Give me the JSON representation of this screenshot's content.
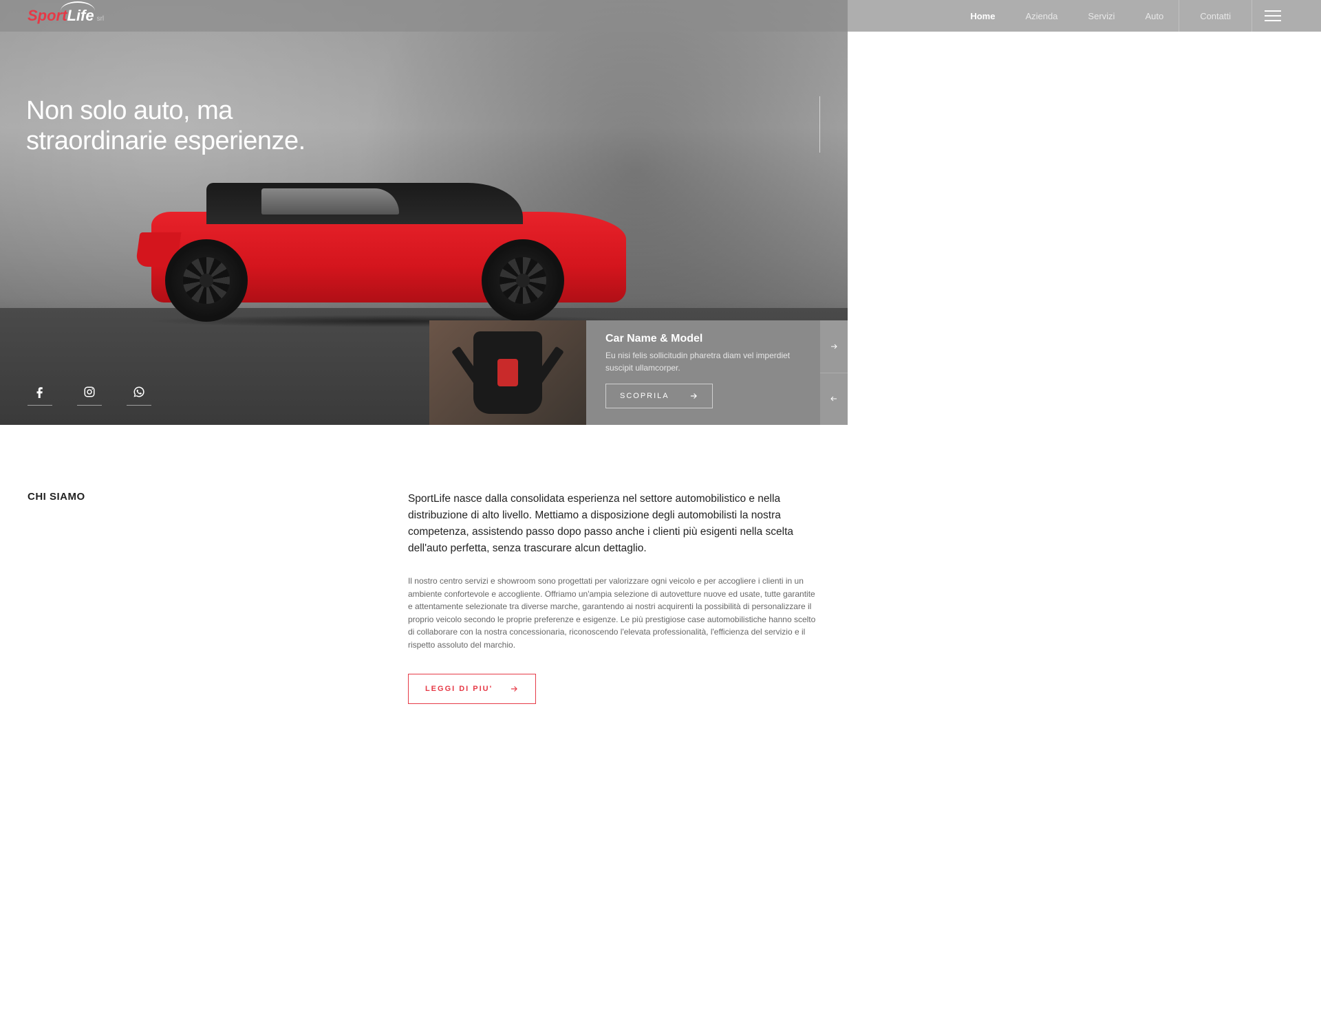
{
  "brand": {
    "part1": "Sport",
    "part2": "Life",
    "suffix": "srl"
  },
  "nav": {
    "items": [
      {
        "label": "Home",
        "active": true
      },
      {
        "label": "Azienda",
        "active": false
      },
      {
        "label": "Servizi",
        "active": false
      },
      {
        "label": "Auto",
        "active": false
      },
      {
        "label": "Contatti",
        "active": false
      }
    ]
  },
  "hero": {
    "title_line1": "Non solo auto, ma",
    "title_line2": "straordinarie esperienze."
  },
  "socials": [
    {
      "name": "facebook"
    },
    {
      "name": "instagram"
    },
    {
      "name": "whatsapp"
    }
  ],
  "featured": {
    "title": "Car Name & Model",
    "description": "Eu nisi felis sollicitudin pharetra diam vel imperdiet suscipit ullamcorper.",
    "cta": "SCOPRILA"
  },
  "about": {
    "heading": "CHI SIAMO",
    "lead": "SportLife nasce dalla consolidata esperienza nel settore automobilistico e nella distribuzione di alto livello. Mettiamo a disposizione degli automobilisti la nostra competenza, assistendo passo dopo passo anche i clienti più esigenti nella scelta dell'auto perfetta, senza trascurare alcun dettaglio.",
    "paragraph": "Il nostro centro servizi e showroom sono progettati per valorizzare ogni veicolo e per accogliere i clienti in un ambiente confortevole e accogliente. Offriamo un'ampia selezione di autovetture nuove ed usate, tutte garantite e attentamente selezionate tra diverse marche, garantendo ai nostri acquirenti la possibilità di personalizzare il proprio veicolo secondo le proprie preferenze e esigenze. Le più prestigiose case automobilistiche hanno scelto di collaborare con la nostra concessionaria, riconoscendo l'elevata professionalità, l'efficienza del servizio e il rispetto assoluto del marchio.",
    "cta": "LEGGI DI PIU'"
  },
  "colors": {
    "accent": "#e63946"
  }
}
